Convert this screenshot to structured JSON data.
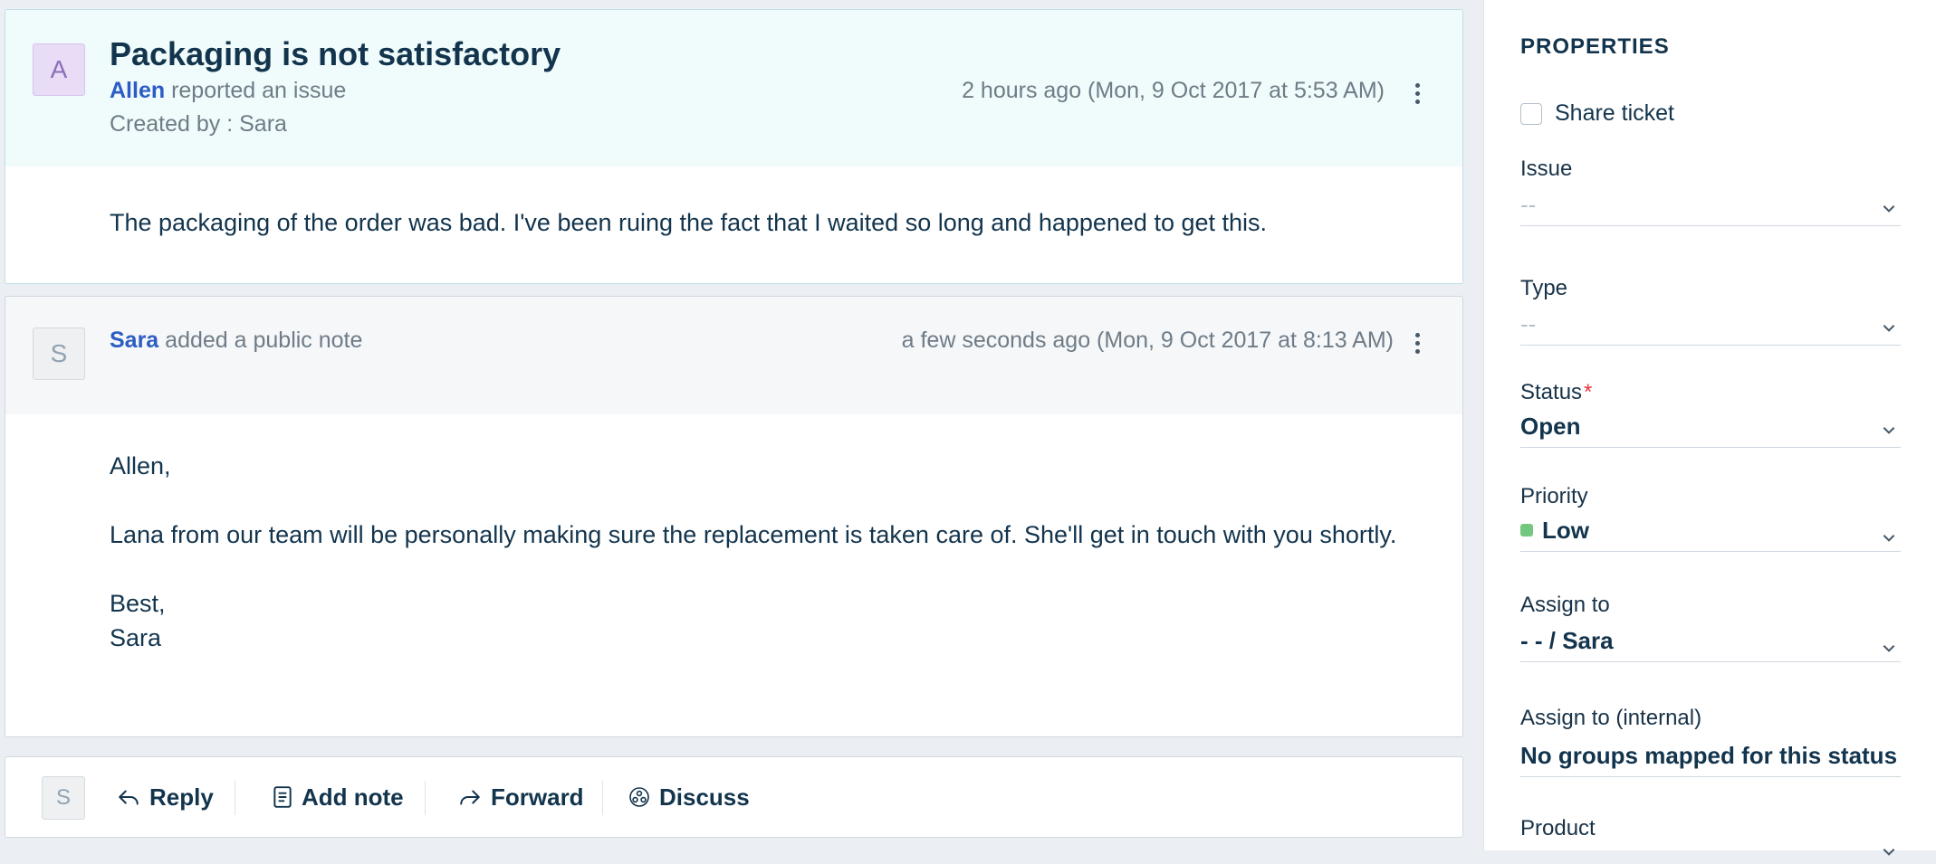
{
  "issue": {
    "avatar_initial": "A",
    "title": "Packaging is not satisfactory",
    "reporter": "Allen",
    "action": "reported an issue",
    "created_by": "Created by : Sara",
    "time": "2 hours ago (Mon, 9 Oct 2017 at 5:53 AM)",
    "body": "The packaging of the order was bad. I've been ruing the fact that I waited so long and happened to get this."
  },
  "note": {
    "avatar_initial": "S",
    "author": "Sara",
    "action": "added a public note",
    "time": "a few seconds ago (Mon, 9 Oct 2017 at 8:13 AM)",
    "body": {
      "greeting": "Allen,",
      "paragraph": "Lana from our team will be personally making sure the replacement is taken care of. She'll get in touch with you shortly.",
      "closing": "Best,",
      "signature": "Sara"
    }
  },
  "reply_bar": {
    "avatar_initial": "S",
    "reply_label": "Reply",
    "add_note_label": "Add note",
    "forward_label": "Forward",
    "discuss_label": "Discuss"
  },
  "properties": {
    "title": "PROPERTIES",
    "share_ticket_label": "Share ticket",
    "share_ticket_checked": false,
    "fields": {
      "issue": {
        "label": "Issue",
        "value": "--"
      },
      "type": {
        "label": "Type",
        "value": "--"
      },
      "status": {
        "label": "Status",
        "required_mark": "*",
        "value": "Open"
      },
      "priority": {
        "label": "Priority",
        "value": "Low",
        "color": "#74c77f"
      },
      "assign_to": {
        "label": "Assign to",
        "value": "- - / Sara"
      },
      "assign_internal": {
        "label": "Assign to (internal)",
        "value": "No groups mapped for this status"
      },
      "product": {
        "label": "Product"
      }
    }
  },
  "colors": {
    "accent_link": "#2c5cc5",
    "issue_header_bg": "#f0fbfb",
    "note_header_bg": "#f5f7f9",
    "required": "#e43538"
  }
}
